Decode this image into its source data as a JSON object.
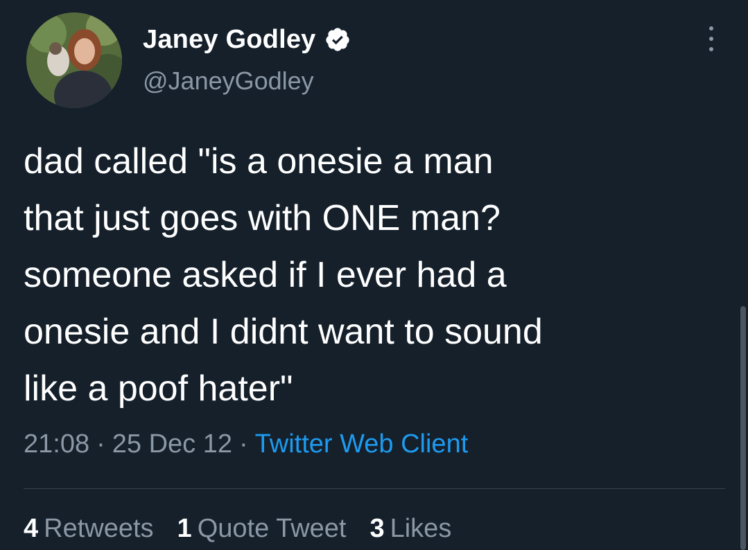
{
  "author": {
    "display_name": "Janey Godley",
    "handle": "@JaneyGodley",
    "verified": true
  },
  "tweet": {
    "text": "dad called \"is a onesie a man\nthat just goes with ONE man?\nsomeone asked if I ever had a\nonesie and I didnt want to sound\nlike a poof hater\"",
    "time": "21:08",
    "date": "25 Dec 12",
    "source": "Twitter Web Client",
    "separator": "·"
  },
  "stats": {
    "retweets_count": "4",
    "retweets_label": "Retweets",
    "quotes_count": "1",
    "quotes_label": "Quote Tweet",
    "likes_count": "3",
    "likes_label": "Likes"
  },
  "icons": {
    "verified": "verified-badge-icon",
    "more": "more-options-icon"
  },
  "colors": {
    "background": "#15202b",
    "text_primary": "#ffffff",
    "text_secondary": "#8b98a5",
    "accent": "#1d9bf0",
    "divider": "#38444d"
  }
}
